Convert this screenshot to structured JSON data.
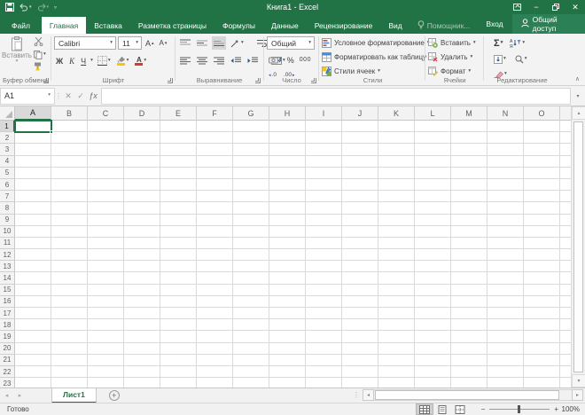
{
  "app": {
    "accent_color": "#217346",
    "share_button_color": "#2c8055"
  },
  "titlebar": {
    "title": "Книга1 - Excel"
  },
  "tabrow": {
    "file": "Файл",
    "tabs": [
      {
        "label": "Главная",
        "active": true
      },
      {
        "label": "Вставка",
        "active": false
      },
      {
        "label": "Разметка страницы",
        "active": false
      },
      {
        "label": "Формулы",
        "active": false
      },
      {
        "label": "Данные",
        "active": false
      },
      {
        "label": "Рецензирование",
        "active": false
      },
      {
        "label": "Вид",
        "active": false
      }
    ],
    "assistant": "Помощник...",
    "signin": "Вход",
    "share": "Общий доступ"
  },
  "ribbon": {
    "clipboard": {
      "label": "Буфер обмена",
      "paste": "Вставить"
    },
    "font": {
      "label": "Шрифт",
      "family": "Calibri",
      "size": "11",
      "bold": "Ж",
      "italic": "К",
      "underline": "Ч",
      "grow": "А",
      "shrink": "А",
      "fontcolor": "А"
    },
    "alignment": {
      "label": "Выравнивание"
    },
    "number": {
      "label": "Число",
      "format": "Общий",
      "percent": "%",
      "thousands": "000",
      "inc_decimal": ".0",
      "dec_decimal": ".00"
    },
    "styles": {
      "label": "Стили",
      "items": [
        "Условное форматирование",
        "Форматировать как таблицу",
        "Стили ячеек"
      ]
    },
    "cells": {
      "label": "Ячейки",
      "items": [
        "Вставить",
        "Удалить",
        "Формат"
      ]
    },
    "editing": {
      "label": "Редактирование",
      "autosum": "Σ"
    }
  },
  "formula_bar": {
    "name_box": "A1",
    "cancel": "✕",
    "enter": "✓",
    "fx": "ƒx",
    "value": ""
  },
  "grid": {
    "columns": [
      "A",
      "B",
      "C",
      "D",
      "E",
      "F",
      "G",
      "H",
      "I",
      "J",
      "K",
      "L",
      "M",
      "N",
      "O"
    ],
    "row_count": 23,
    "selected_cell": "A1",
    "selected_column": "A",
    "selected_row": "1"
  },
  "sheet_bar": {
    "sheets": [
      {
        "name": "Лист1",
        "active": true
      }
    ]
  },
  "status_bar": {
    "ready": "Готово",
    "zoom_level": "100%"
  }
}
